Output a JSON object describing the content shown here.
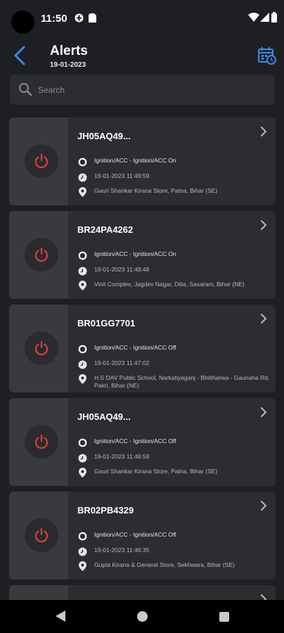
{
  "status_bar": {
    "time": "11:50"
  },
  "header": {
    "title": "Alerts",
    "date": "19-01-2023"
  },
  "search": {
    "placeholder": "Search"
  },
  "colors": {
    "accent": "#3a8cf0",
    "power_red": "#d8413a",
    "background": "#1e1f22",
    "card": "#2c2d31"
  },
  "alerts": [
    {
      "plate": "JH05AQ49...",
      "event": "Ignition/ACC  -  Ignition/ACC On",
      "datetime": "19-01-2023 11:49:59",
      "location": "Gauri Shankar Kirana Store, Patna, Bihar (SE)"
    },
    {
      "plate": "BR24PA4262",
      "event": "Ignition/ACC  -  Ignition/ACC On",
      "datetime": "19-01-2023 11:49:48",
      "location": "Vinit Complex, Jagdev Nagar, Dilia, Sasaram, Bihar (NE)"
    },
    {
      "plate": "BR01GG7701",
      "event": "Ignition/ACC  -  Ignition/ACC Off",
      "datetime": "19-01-2023 11:47:02",
      "location": "H.S DAV Public School, Narkatiyaganj - Bhitiharwa - Gaunaha Rd, Pakri, Bihar (NE)"
    },
    {
      "plate": "JH05AQ49...",
      "event": "Ignition/ACC  -  Ignition/ACC Off",
      "datetime": "19-01-2023 11:46:59",
      "location": "Gauri Shankar Kirana Store, Patna, Bihar (SE)"
    },
    {
      "plate": "BR02PB4329",
      "event": "Ignition/ACC  -  Ignition/ACC Off",
      "datetime": "19-01-2023 11:46:35",
      "location": "Gupta Kirana & General Store, Sekhwara, Bihar (SE)"
    }
  ]
}
